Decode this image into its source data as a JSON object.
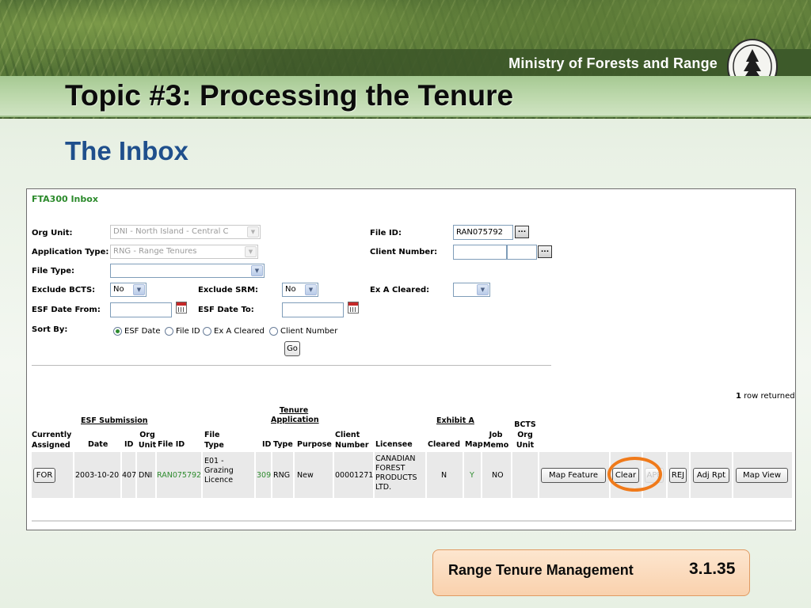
{
  "slide": {
    "ministry": "Ministry of Forests and Range",
    "seal_text": [
      "FOREST SERVICE",
      "BRITISH COLUMBIA"
    ],
    "title": "Topic #3: Processing the Tenure",
    "subtitle": "The Inbox",
    "footer_label": "Range Tenure Management",
    "footer_number": "3.1.35"
  },
  "app": {
    "title": "FTA300 Inbox",
    "filters": {
      "org_unit": {
        "label": "Org Unit:",
        "value": "DNI - North Island - Central C"
      },
      "application_type": {
        "label": "Application Type:",
        "value": "RNG - Range Tenures"
      },
      "file_type": {
        "label": "File Type:",
        "value": ""
      },
      "exclude_bcts": {
        "label": "Exclude BCTS:",
        "value": "No"
      },
      "exclude_srm": {
        "label": "Exclude SRM:",
        "value": "No"
      },
      "esf_date_from": {
        "label": "ESF Date From:",
        "value": ""
      },
      "esf_date_to": {
        "label": "ESF Date To:",
        "value": ""
      },
      "file_id": {
        "label": "File ID:",
        "value": "RAN075792"
      },
      "client_number": {
        "label": "Client Number:",
        "value": ""
      },
      "ex_a_cleared": {
        "label": "Ex A Cleared:",
        "value": ""
      },
      "ellipsis": "...",
      "sort_by": {
        "label": "Sort By:",
        "options": [
          "ESF Date",
          "File ID",
          "Ex A Cleared",
          "Client Number"
        ],
        "selected": "ESF Date"
      },
      "go_button": "Go"
    },
    "rows_returned_count": "1",
    "rows_returned_text": "row returned",
    "table": {
      "group_headers": {
        "esf_submission": "ESF Submission",
        "tenure_application": "Tenure Application",
        "exhibit_a": "Exhibit A"
      },
      "headers": {
        "currently_assigned": "Currently Assigned",
        "date": "Date",
        "esf_id": "ID",
        "org_unit": "Org Unit",
        "file_id": "File ID",
        "file_type": "File Type",
        "app_id": "ID",
        "type": "Type",
        "purpose": "Purpose",
        "client_number": "Client Number",
        "licensee": "Licensee",
        "cleared": "Cleared",
        "map": "Map",
        "job_memo": "Job Memo",
        "bcts_org_unit": "BCTS Org Unit"
      },
      "rows": [
        {
          "currently_assigned": "FOR",
          "date": "2003-10-20",
          "esf_id": "407",
          "org_unit": "DNI",
          "file_id": "RAN075792",
          "file_type": "E01 - Grazing Licence",
          "app_id": "309",
          "type": "RNG",
          "purpose": "New",
          "client_number": "00001271",
          "licensee": "CANADIAN FOREST PRODUCTS LTD.",
          "cleared": "N",
          "map": "Y",
          "job_memo": "NO",
          "bcts_org_unit": ""
        }
      ],
      "row_actions": [
        "Map Feature",
        "Clear",
        "APP",
        "REJ",
        "Adj Rpt",
        "Map View"
      ]
    }
  }
}
